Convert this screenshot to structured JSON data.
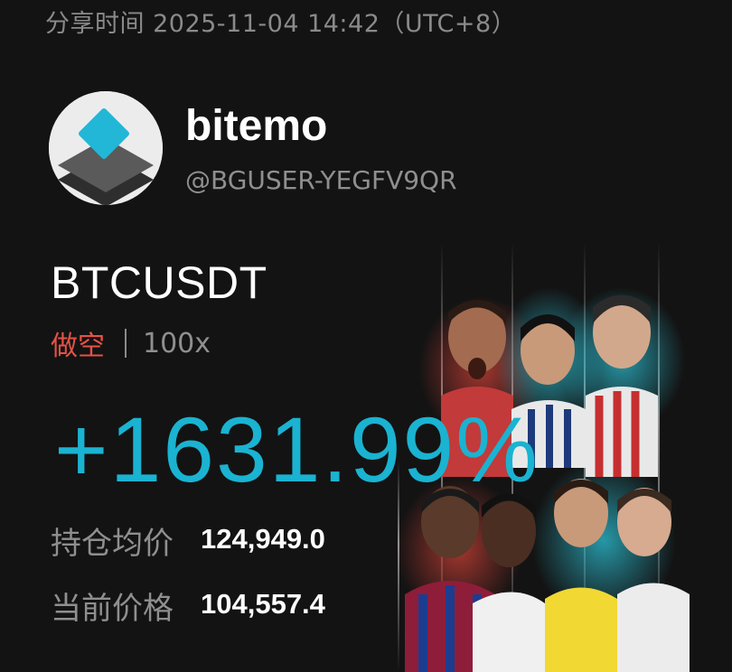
{
  "share_time": "分享时间 2025-11-04 14:42（UTC+8）",
  "user": {
    "name": "bitemo",
    "handle": "@BGUSER-YEGFV9QR"
  },
  "position": {
    "pair": "BTCUSDT",
    "side": "做空",
    "leverage": "100x",
    "pnl_percent": "+1631.99%",
    "entry_price_label": "持仓均价",
    "entry_price": "124,949.0",
    "mark_price_label": "当前价格",
    "mark_price": "104,557.4"
  },
  "colors": {
    "background": "#131313",
    "profit": "#1ab3d1",
    "short": "#e55246",
    "secondary_text": "#8f8f8f"
  },
  "icons": {
    "avatar": "diamond-logo-avatar",
    "promo_art": "football-players-banner"
  }
}
